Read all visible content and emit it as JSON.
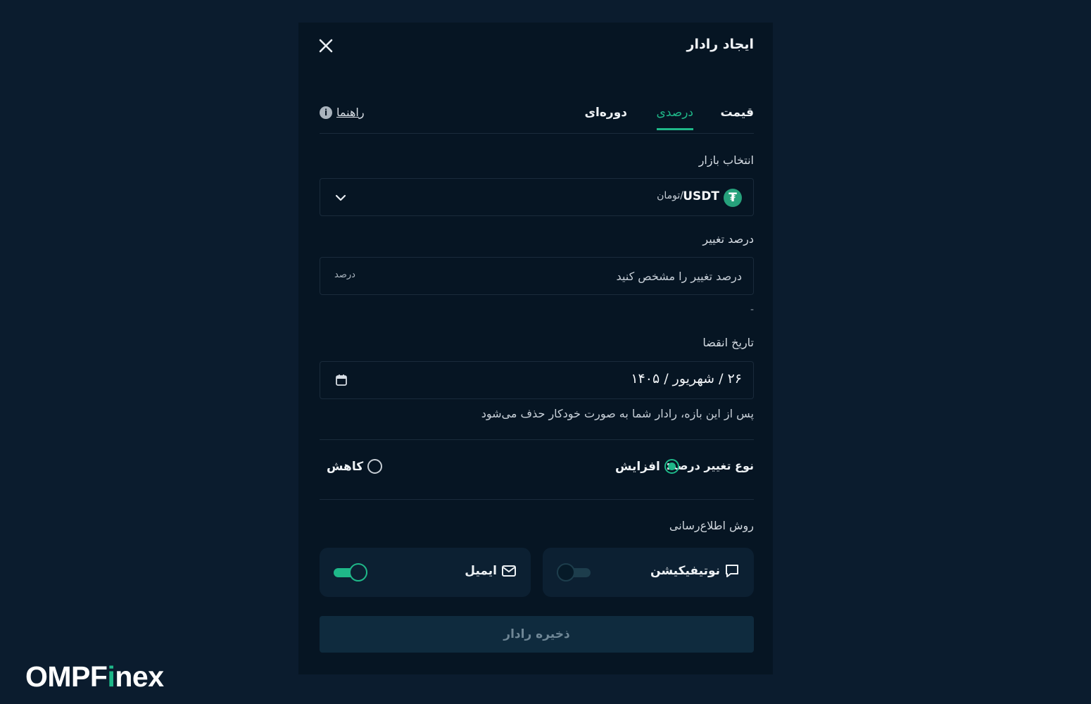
{
  "modal": {
    "title": "ایجاد رادار"
  },
  "tabs": [
    {
      "label": "قیمت",
      "active": false
    },
    {
      "label": "درصدی",
      "active": true
    },
    {
      "label": "دوره‌ای",
      "active": false
    }
  ],
  "guide": {
    "label": "راهنما",
    "icon": "info-icon"
  },
  "market": {
    "label": "انتخاب بازار",
    "coin_symbol": "USDT",
    "quote": "/تومان",
    "coin_icon": "tether-icon",
    "coin_color": "#26a17b"
  },
  "percent": {
    "label": "درصد تغییر",
    "placeholder": "درصد تغییر را مشخص کنید",
    "unit": "درصد",
    "helper": "-"
  },
  "expiry": {
    "label": "تاریخ انقضا",
    "value": "۲۶ / شهریور / ۱۴۰۵",
    "hint": "پس از این بازه، رادار شما به صورت خودکار حذف می‌شود"
  },
  "change_type": {
    "label": "نوع تغییر درصد:",
    "options": [
      {
        "label": "افزایش",
        "selected": true
      },
      {
        "label": "کاهش",
        "selected": false
      }
    ]
  },
  "notification": {
    "label": "روش اطلاع‌رسانی",
    "methods": [
      {
        "label": "نوتیفیکیشن",
        "icon": "message-icon",
        "enabled": false
      },
      {
        "label": "ایمیل",
        "icon": "mail-icon",
        "enabled": true
      }
    ]
  },
  "save_button": {
    "label": "ذخیره رادار"
  },
  "brand": {
    "name_main": "OMPF",
    "name_accent": "i",
    "name_tail": "nex"
  },
  "colors": {
    "accent": "#1fb889",
    "background": "#0b1c2e",
    "modal_bg": "#061523",
    "card_bg": "#0c2032",
    "button_disabled_bg": "#0f2b3e"
  }
}
